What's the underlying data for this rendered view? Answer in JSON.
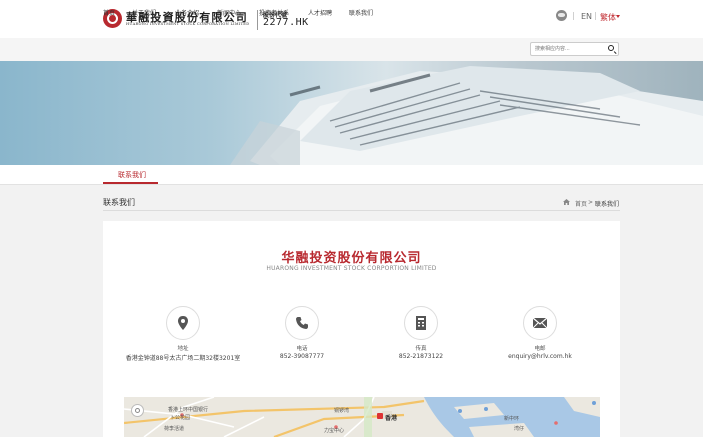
{
  "header": {
    "logo_cn": "華融投資股份有限公司",
    "logo_en": "HUARONG INVESTMENT STOCK CORPORATION LIMITED",
    "stock_label": "股份代號",
    "stock_code": "2277.HK",
    "lang_en": "EN",
    "lang_separator": "|",
    "lang_tc": "繁体"
  },
  "nav": {
    "items": [
      {
        "label": "首页"
      },
      {
        "label": "关于我们"
      },
      {
        "label": "业务介绍"
      },
      {
        "label": "新闻中心"
      },
      {
        "label": "投资者关系"
      },
      {
        "label": "人才招聘"
      },
      {
        "label": "联系我们"
      }
    ],
    "search_placeholder": "搜索相应内容..."
  },
  "tabs": {
    "active": "联系我们"
  },
  "breadcrumb": {
    "page_title": "联系我们",
    "home": "首页",
    "separator": ">",
    "current": "联系我们"
  },
  "company": {
    "name_cn": "华融投资股份有限公司",
    "name_en": "HUARONG INVESTMENT STOCK CORPORTION LIMITED"
  },
  "contacts": [
    {
      "icon": "location-pin-icon",
      "label": "地址",
      "value": "香港金钟道88号太古广场二期32楼3201室"
    },
    {
      "icon": "phone-icon",
      "label": "电话",
      "value": "852-39087777"
    },
    {
      "icon": "fax-icon",
      "label": "传真",
      "value": "852-21873122"
    },
    {
      "icon": "mail-icon",
      "label": "电邮",
      "value": "enquiry@hrlv.com.hk"
    }
  ],
  "map": {
    "labels": [
      "香港上环中国银行",
      "卜公花园",
      "荷李活道",
      "香港",
      "铜锣湾",
      "新中环",
      "湾仔",
      "力宝中心"
    ]
  },
  "colors": {
    "brand_red": "#b8292f",
    "nav_bg": "#f5f5f5",
    "page_bg": "#f2f2f2"
  }
}
